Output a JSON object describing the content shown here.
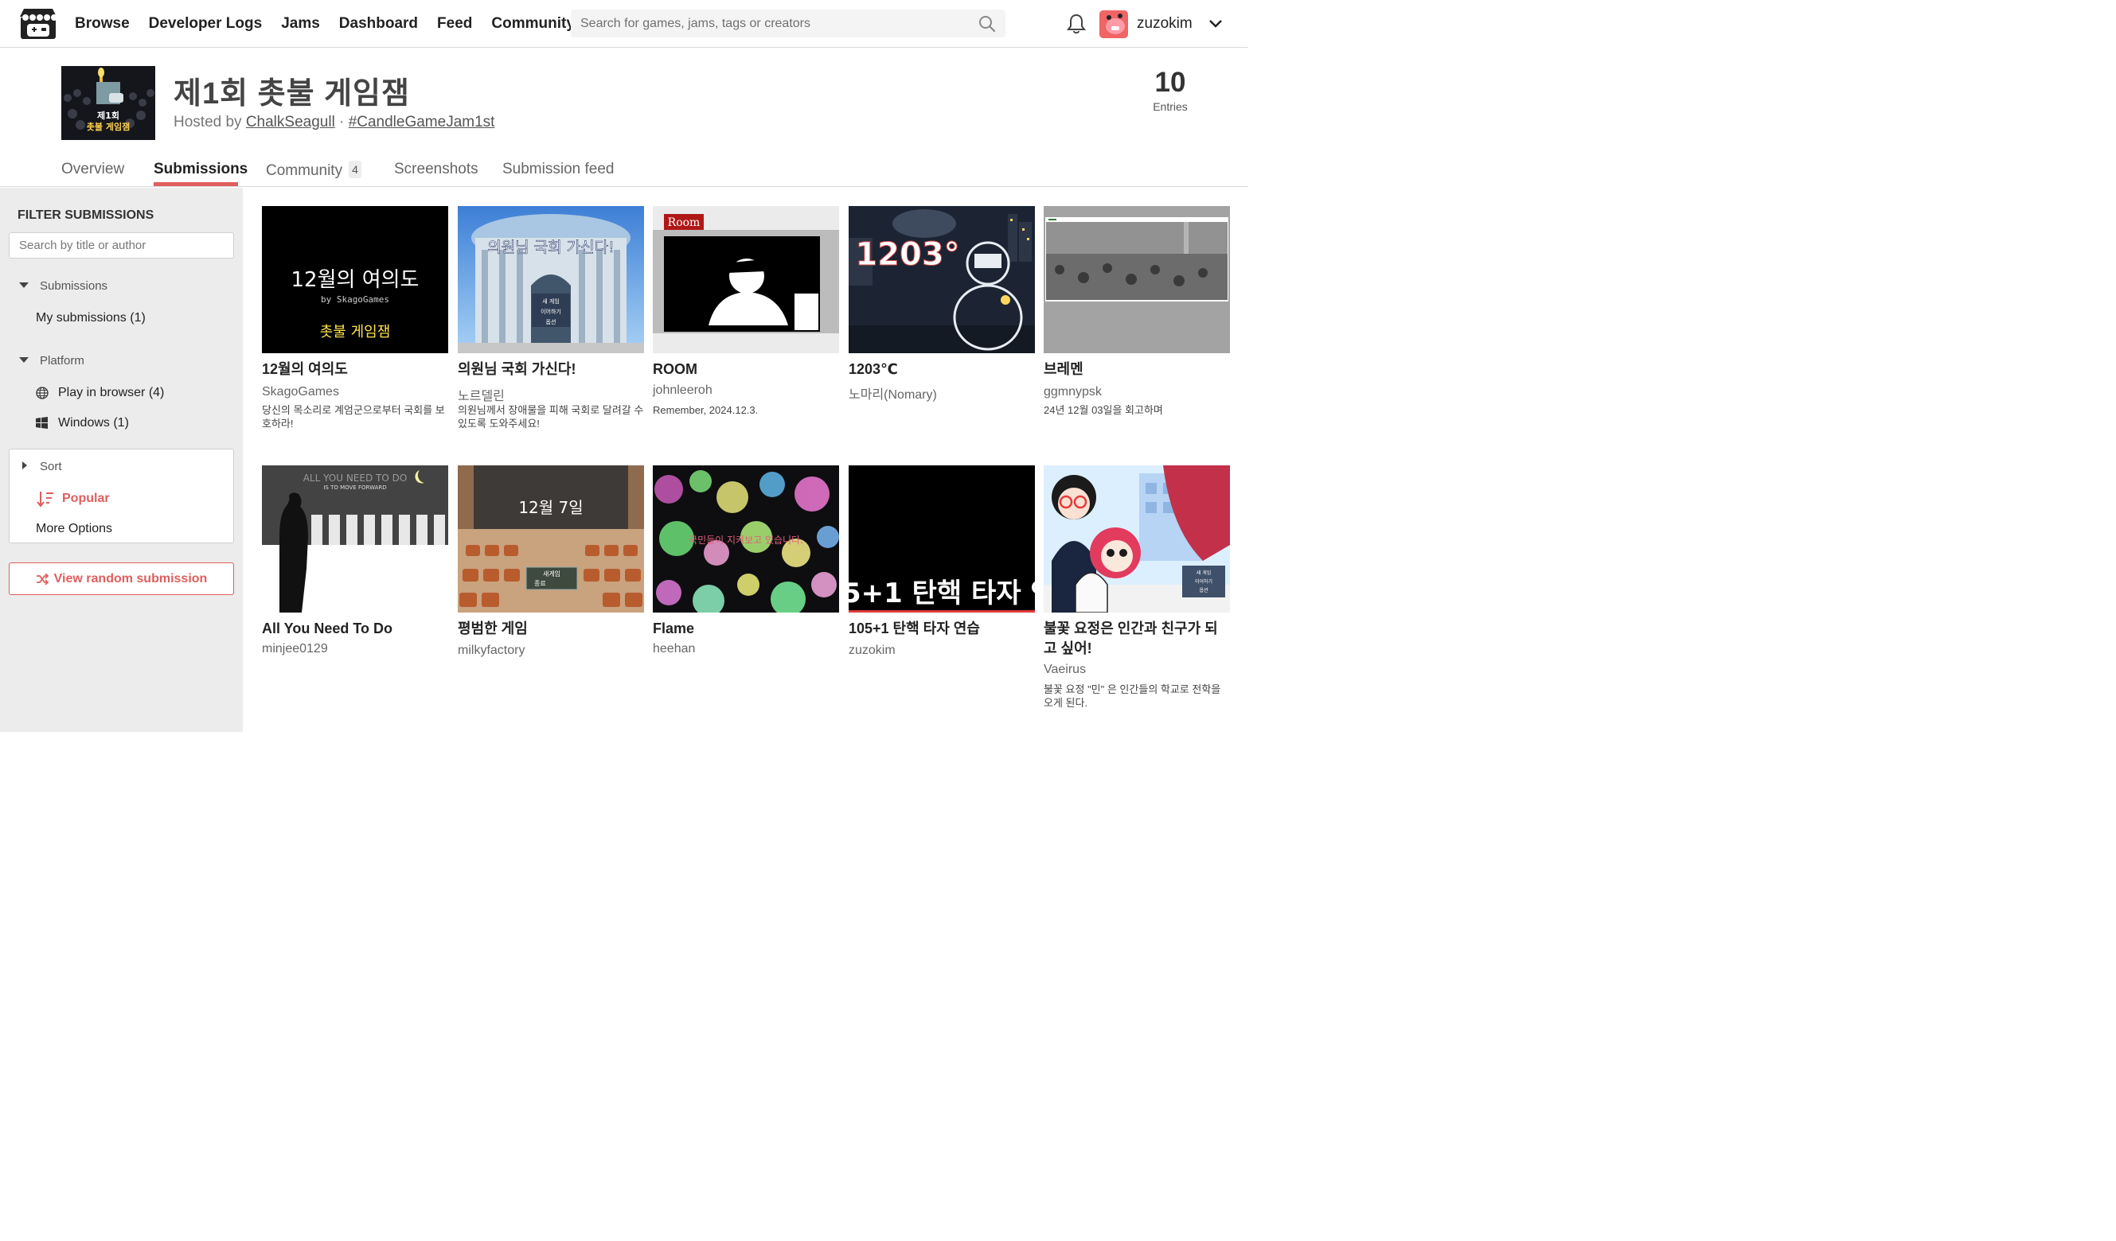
{
  "nav": {
    "links": [
      "Browse",
      "Developer Logs",
      "Jams",
      "Dashboard",
      "Feed",
      "Community"
    ],
    "search_placeholder": "Search for games, jams, tags or creators",
    "username": "zuzokim"
  },
  "jam": {
    "thumb_line1": "제1회",
    "thumb_line2": "촛불 게임잼",
    "title": "제1회 촛불 게임잼",
    "hosted_prefix": "Hosted by",
    "host": "ChalkSeagull",
    "separator": "·",
    "hashtag": "#CandleGameJam1st",
    "entries_count": "10",
    "entries_label": "Entries"
  },
  "tabs": {
    "overview": "Overview",
    "submissions": "Submissions",
    "community": "Community",
    "community_count": "4",
    "screenshots": "Screenshots",
    "submission_feed": "Submission feed"
  },
  "sidebar": {
    "title": "FILTER SUBMISSIONS",
    "search_placeholder": "Search by title or author",
    "submissions_label": "Submissions",
    "my_submissions": "My submissions (1)",
    "platform_label": "Platform",
    "play_in_browser": "Play in browser (4)",
    "windows": "Windows (1)",
    "sort_label": "Sort",
    "popular": "Popular",
    "more_options": "More Options",
    "random_button": "View random submission"
  },
  "games": [
    {
      "title": "12월의 여의도",
      "author": "SkagoGames",
      "description": "당신의 목소리로 계엄군으로부터 국회를 보호하라!",
      "thumb_title": "12월의 여의도",
      "thumb_sub": "by SkagoGames",
      "thumb_tag": "촛불 게임잼"
    },
    {
      "title": "의원님 국회 가신다!",
      "author": "노르델린",
      "description": "의원님께서 장애물을 피해 국회로 달려갈 수 있도록 도와주세요!",
      "thumb_title": "의원님 국회 가신다!",
      "menu": [
        "새 게임",
        "이어하기",
        "옵션"
      ]
    },
    {
      "title": "ROOM",
      "author": "johnleeroh",
      "description": "Remember, 2024.12.3.",
      "thumb_tag": "Room"
    },
    {
      "title": "1203℃",
      "author": "노마리(Nomary)",
      "description": "",
      "thumb_title": "1203°"
    },
    {
      "title": "브레멘",
      "author": "ggmnypsk",
      "description": "24년 12월 03일을 회고하며"
    },
    {
      "title": "All You Need To Do",
      "author": "minjee0129",
      "description": "",
      "thumb_title": "ALL YOU NEED TO DO",
      "thumb_sub": "IS TO MOVE FORWARD"
    },
    {
      "title": "평범한 게임",
      "author": "milkyfactory",
      "description": "",
      "thumb_title": "12월 7일",
      "menu": [
        "새게임",
        "종료"
      ]
    },
    {
      "title": "Flame",
      "author": "heehan",
      "description": "",
      "thumb_title": "국민들이 지켜보고 있습니다."
    },
    {
      "title": "105+1 탄핵 타자 연습",
      "author": "zuzokim",
      "description": "",
      "thumb_title": "5+1 탄핵 타자 연"
    },
    {
      "title": "불꽃 요정은 인간과 친구가 되고 싶어!",
      "author": "Vaeirus",
      "description": "불꽃 요정 \"민\" 은 인간들의 학교로 전학을 오게 된다.",
      "menu": [
        "새 게임",
        "이어하기",
        "옵션"
      ]
    }
  ],
  "colors": {
    "accent": "#e05e5e",
    "sidebar_bg": "#ececec",
    "avatar": "#f06464"
  },
  "icons": [
    "itchio-logo-icon",
    "search-icon",
    "bell-icon",
    "chevron-down-icon",
    "globe-icon",
    "windows-icon",
    "sort-icon",
    "shuffle-icon"
  ]
}
